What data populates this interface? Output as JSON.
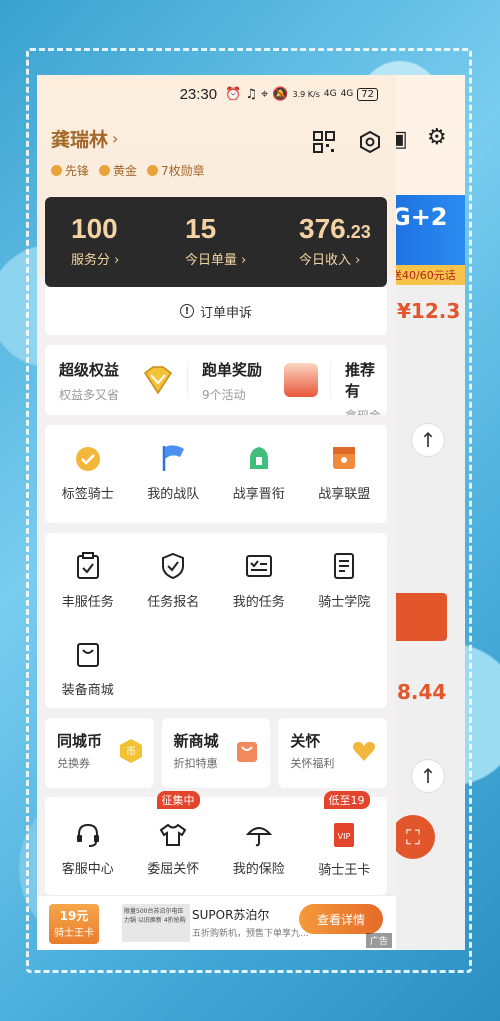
{
  "status_bar": {
    "time": "23:30",
    "speed": "3.9 K/s",
    "net1": "4G",
    "net2": "4G",
    "battery": "72"
  },
  "header": {
    "name": "龚瑞林",
    "chevron": "›",
    "badges": [
      "先锋",
      "黄金",
      "7枚勋章"
    ]
  },
  "stats": [
    {
      "value": "100",
      "label": "服务分 ›"
    },
    {
      "value": "15",
      "label": "今日单量 ›"
    },
    {
      "value_main": "376",
      "value_dec": ".23",
      "label": "今日收入 ›"
    }
  ],
  "appeal": {
    "icon": "!",
    "label": "订单申诉"
  },
  "promos": [
    {
      "title": "超级权益",
      "sub": "权益多又省"
    },
    {
      "title": "跑单奖励",
      "sub": "9个活动"
    },
    {
      "title": "推荐有",
      "sub": "拿现金"
    }
  ],
  "grid1": [
    "标签骑士",
    "我的战队",
    "战享晋衔",
    "战享联盟"
  ],
  "grid2": [
    "丰服任务",
    "任务报名",
    "我的任务",
    "骑士学院",
    "装备商城"
  ],
  "row3": [
    {
      "title": "同城币",
      "sub": "兑换券",
      "icon_text": "币"
    },
    {
      "title": "新商城",
      "sub": "折扣特惠"
    },
    {
      "title": "关怀",
      "sub": "关怀福利"
    }
  ],
  "grid3": [
    "客服中心",
    "委屈关怀",
    "我的保险",
    "骑士王卡"
  ],
  "tags": {
    "collecting": "征集中",
    "discount": "低至19",
    "vip": "VIP"
  },
  "ad": {
    "card_price": "19元",
    "card_name": "骑士王卡",
    "brand": "SUPOR苏泊尔",
    "desc": "五折购新机，预售下单享九...",
    "button": "查看详情",
    "tag": "广告",
    "thumb_text": "限量500台苏泊尔电压力锅 以旧换新 4折抢购"
  },
  "back": {
    "banner": "G+2",
    "banner_sub": "送40/60元话",
    "price1": "¥12.3",
    "price2": "8.44"
  },
  "colors": {
    "accent_gold": "#a3682a",
    "stats_bg": "#2a2a2a",
    "stats_text": "#f3d3a3",
    "red": "#e2452b"
  }
}
